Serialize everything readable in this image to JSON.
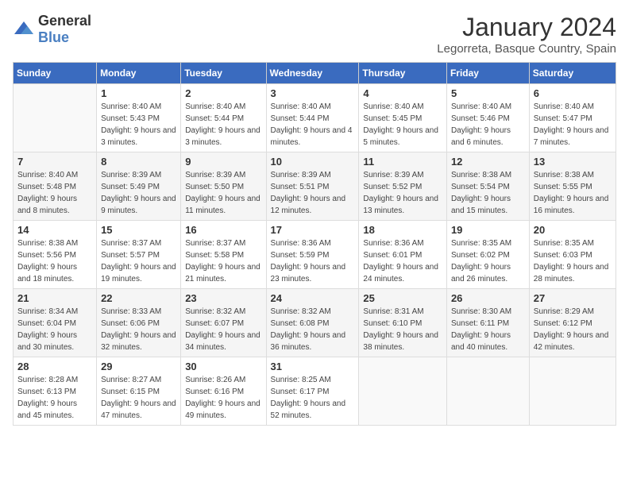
{
  "header": {
    "logo_general": "General",
    "logo_blue": "Blue",
    "month": "January 2024",
    "location": "Legorreta, Basque Country, Spain"
  },
  "days_of_week": [
    "Sunday",
    "Monday",
    "Tuesday",
    "Wednesday",
    "Thursday",
    "Friday",
    "Saturday"
  ],
  "weeks": [
    [
      {
        "day": "",
        "sunrise": "",
        "sunset": "",
        "daylight": ""
      },
      {
        "day": "1",
        "sunrise": "Sunrise: 8:40 AM",
        "sunset": "Sunset: 5:43 PM",
        "daylight": "Daylight: 9 hours and 3 minutes."
      },
      {
        "day": "2",
        "sunrise": "Sunrise: 8:40 AM",
        "sunset": "Sunset: 5:44 PM",
        "daylight": "Daylight: 9 hours and 3 minutes."
      },
      {
        "day": "3",
        "sunrise": "Sunrise: 8:40 AM",
        "sunset": "Sunset: 5:44 PM",
        "daylight": "Daylight: 9 hours and 4 minutes."
      },
      {
        "day": "4",
        "sunrise": "Sunrise: 8:40 AM",
        "sunset": "Sunset: 5:45 PM",
        "daylight": "Daylight: 9 hours and 5 minutes."
      },
      {
        "day": "5",
        "sunrise": "Sunrise: 8:40 AM",
        "sunset": "Sunset: 5:46 PM",
        "daylight": "Daylight: 9 hours and 6 minutes."
      },
      {
        "day": "6",
        "sunrise": "Sunrise: 8:40 AM",
        "sunset": "Sunset: 5:47 PM",
        "daylight": "Daylight: 9 hours and 7 minutes."
      }
    ],
    [
      {
        "day": "7",
        "sunrise": "Sunrise: 8:40 AM",
        "sunset": "Sunset: 5:48 PM",
        "daylight": "Daylight: 9 hours and 8 minutes."
      },
      {
        "day": "8",
        "sunrise": "Sunrise: 8:39 AM",
        "sunset": "Sunset: 5:49 PM",
        "daylight": "Daylight: 9 hours and 9 minutes."
      },
      {
        "day": "9",
        "sunrise": "Sunrise: 8:39 AM",
        "sunset": "Sunset: 5:50 PM",
        "daylight": "Daylight: 9 hours and 11 minutes."
      },
      {
        "day": "10",
        "sunrise": "Sunrise: 8:39 AM",
        "sunset": "Sunset: 5:51 PM",
        "daylight": "Daylight: 9 hours and 12 minutes."
      },
      {
        "day": "11",
        "sunrise": "Sunrise: 8:39 AM",
        "sunset": "Sunset: 5:52 PM",
        "daylight": "Daylight: 9 hours and 13 minutes."
      },
      {
        "day": "12",
        "sunrise": "Sunrise: 8:38 AM",
        "sunset": "Sunset: 5:54 PM",
        "daylight": "Daylight: 9 hours and 15 minutes."
      },
      {
        "day": "13",
        "sunrise": "Sunrise: 8:38 AM",
        "sunset": "Sunset: 5:55 PM",
        "daylight": "Daylight: 9 hours and 16 minutes."
      }
    ],
    [
      {
        "day": "14",
        "sunrise": "Sunrise: 8:38 AM",
        "sunset": "Sunset: 5:56 PM",
        "daylight": "Daylight: 9 hours and 18 minutes."
      },
      {
        "day": "15",
        "sunrise": "Sunrise: 8:37 AM",
        "sunset": "Sunset: 5:57 PM",
        "daylight": "Daylight: 9 hours and 19 minutes."
      },
      {
        "day": "16",
        "sunrise": "Sunrise: 8:37 AM",
        "sunset": "Sunset: 5:58 PM",
        "daylight": "Daylight: 9 hours and 21 minutes."
      },
      {
        "day": "17",
        "sunrise": "Sunrise: 8:36 AM",
        "sunset": "Sunset: 5:59 PM",
        "daylight": "Daylight: 9 hours and 23 minutes."
      },
      {
        "day": "18",
        "sunrise": "Sunrise: 8:36 AM",
        "sunset": "Sunset: 6:01 PM",
        "daylight": "Daylight: 9 hours and 24 minutes."
      },
      {
        "day": "19",
        "sunrise": "Sunrise: 8:35 AM",
        "sunset": "Sunset: 6:02 PM",
        "daylight": "Daylight: 9 hours and 26 minutes."
      },
      {
        "day": "20",
        "sunrise": "Sunrise: 8:35 AM",
        "sunset": "Sunset: 6:03 PM",
        "daylight": "Daylight: 9 hours and 28 minutes."
      }
    ],
    [
      {
        "day": "21",
        "sunrise": "Sunrise: 8:34 AM",
        "sunset": "Sunset: 6:04 PM",
        "daylight": "Daylight: 9 hours and 30 minutes."
      },
      {
        "day": "22",
        "sunrise": "Sunrise: 8:33 AM",
        "sunset": "Sunset: 6:06 PM",
        "daylight": "Daylight: 9 hours and 32 minutes."
      },
      {
        "day": "23",
        "sunrise": "Sunrise: 8:32 AM",
        "sunset": "Sunset: 6:07 PM",
        "daylight": "Daylight: 9 hours and 34 minutes."
      },
      {
        "day": "24",
        "sunrise": "Sunrise: 8:32 AM",
        "sunset": "Sunset: 6:08 PM",
        "daylight": "Daylight: 9 hours and 36 minutes."
      },
      {
        "day": "25",
        "sunrise": "Sunrise: 8:31 AM",
        "sunset": "Sunset: 6:10 PM",
        "daylight": "Daylight: 9 hours and 38 minutes."
      },
      {
        "day": "26",
        "sunrise": "Sunrise: 8:30 AM",
        "sunset": "Sunset: 6:11 PM",
        "daylight": "Daylight: 9 hours and 40 minutes."
      },
      {
        "day": "27",
        "sunrise": "Sunrise: 8:29 AM",
        "sunset": "Sunset: 6:12 PM",
        "daylight": "Daylight: 9 hours and 42 minutes."
      }
    ],
    [
      {
        "day": "28",
        "sunrise": "Sunrise: 8:28 AM",
        "sunset": "Sunset: 6:13 PM",
        "daylight": "Daylight: 9 hours and 45 minutes."
      },
      {
        "day": "29",
        "sunrise": "Sunrise: 8:27 AM",
        "sunset": "Sunset: 6:15 PM",
        "daylight": "Daylight: 9 hours and 47 minutes."
      },
      {
        "day": "30",
        "sunrise": "Sunrise: 8:26 AM",
        "sunset": "Sunset: 6:16 PM",
        "daylight": "Daylight: 9 hours and 49 minutes."
      },
      {
        "day": "31",
        "sunrise": "Sunrise: 8:25 AM",
        "sunset": "Sunset: 6:17 PM",
        "daylight": "Daylight: 9 hours and 52 minutes."
      },
      {
        "day": "",
        "sunrise": "",
        "sunset": "",
        "daylight": ""
      },
      {
        "day": "",
        "sunrise": "",
        "sunset": "",
        "daylight": ""
      },
      {
        "day": "",
        "sunrise": "",
        "sunset": "",
        "daylight": ""
      }
    ]
  ]
}
